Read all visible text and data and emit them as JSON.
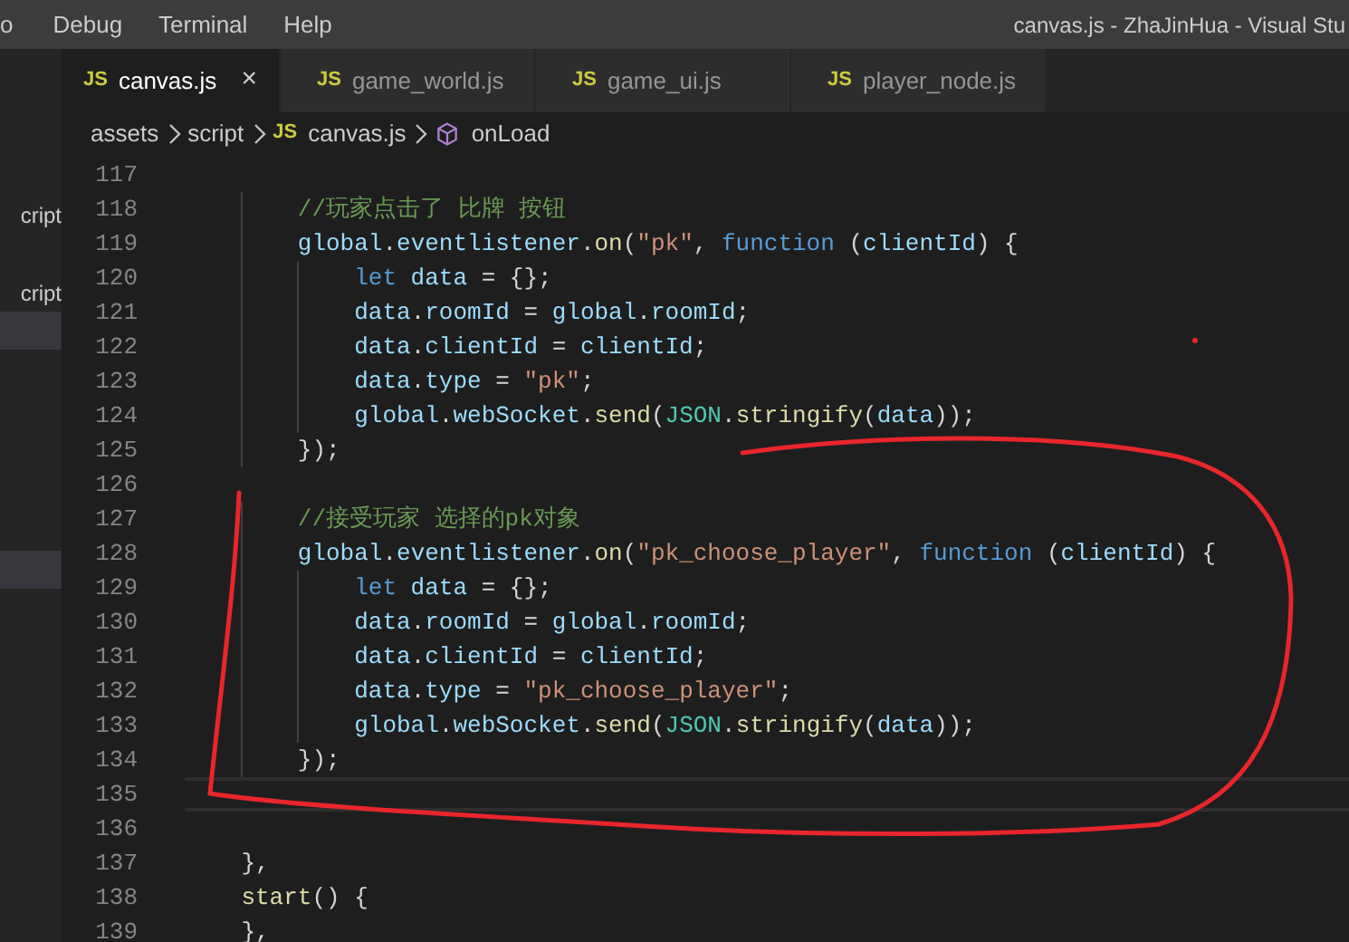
{
  "menu_bar": {
    "items": [
      "o",
      "Debug",
      "Terminal",
      "Help"
    ],
    "title": "canvas.js - ZhaJinHua - Visual Stu"
  },
  "sidebar": {
    "items": [
      {
        "label": "cript",
        "selected": false
      },
      {
        "label": "cript",
        "selected": false
      },
      {
        "selected": true
      },
      {
        "selected": true
      }
    ]
  },
  "tabs": [
    {
      "label": "canvas.js",
      "selected": true,
      "icon": "JS"
    },
    {
      "label": "game_world.js",
      "selected": false,
      "icon": "JS"
    },
    {
      "label": "game_ui.js",
      "selected": false,
      "icon": "JS"
    },
    {
      "label": "player_node.js",
      "selected": false,
      "icon": "JS"
    }
  ],
  "close_symbol": "×",
  "breadcrumb": [
    {
      "kind": "folder",
      "label": "assets"
    },
    {
      "kind": "folder",
      "label": "script"
    },
    {
      "kind": "file",
      "label": "canvas.js",
      "icon": "JS"
    },
    {
      "kind": "method",
      "label": "onLoad"
    }
  ],
  "editor": {
    "lines": [
      {
        "number": "117",
        "current": false
      },
      {
        "number": "118",
        "current": false,
        "tokens": [
          {
            "kind": "comment",
            "text": "//玩家点击了 比牌 按钮"
          }
        ]
      },
      {
        "number": "119",
        "current": false,
        "tokens": [
          {
            "kind": "var",
            "text": "global"
          },
          {
            "kind": "plain",
            "text": "."
          },
          {
            "kind": "var",
            "text": "eventlistener"
          },
          {
            "kind": "plain",
            "text": "."
          },
          {
            "kind": "func",
            "text": "on"
          },
          {
            "kind": "plain",
            "text": "("
          },
          {
            "kind": "string",
            "text": "\"pk\""
          },
          {
            "kind": "plain",
            "text": ", "
          },
          {
            "kind": "keyword",
            "text": "function"
          },
          {
            "kind": "plain",
            "text": " ("
          },
          {
            "kind": "var",
            "text": "clientId"
          },
          {
            "kind": "plain",
            "text": ") {"
          }
        ]
      },
      {
        "number": "120",
        "current": false,
        "tokens": [
          {
            "kind": "keyword",
            "text": "let"
          },
          {
            "kind": "var",
            "text": " data"
          },
          {
            "kind": "plain",
            "text": " = {};"
          }
        ]
      },
      {
        "number": "121",
        "current": false,
        "tokens": [
          {
            "kind": "var",
            "text": "data"
          },
          {
            "kind": "plain",
            "text": "."
          },
          {
            "kind": "var",
            "text": "roomId"
          },
          {
            "kind": "plain",
            "text": " = "
          },
          {
            "kind": "var",
            "text": "global"
          },
          {
            "kind": "plain",
            "text": "."
          },
          {
            "kind": "var",
            "text": "roomId"
          },
          {
            "kind": "plain",
            "text": ";"
          }
        ]
      },
      {
        "number": "122",
        "current": false,
        "tokens": [
          {
            "kind": "var",
            "text": "data"
          },
          {
            "kind": "plain",
            "text": "."
          },
          {
            "kind": "var",
            "text": "clientId"
          },
          {
            "kind": "plain",
            "text": " = "
          },
          {
            "kind": "var",
            "text": "clientId"
          },
          {
            "kind": "plain",
            "text": ";"
          }
        ]
      },
      {
        "number": "123",
        "current": false,
        "tokens": [
          {
            "kind": "var",
            "text": "data"
          },
          {
            "kind": "plain",
            "text": "."
          },
          {
            "kind": "var",
            "text": "type"
          },
          {
            "kind": "plain",
            "text": " = "
          },
          {
            "kind": "string",
            "text": "\"pk\""
          },
          {
            "kind": "plain",
            "text": ";"
          }
        ]
      },
      {
        "number": "124",
        "current": false,
        "tokens": [
          {
            "kind": "var",
            "text": "global"
          },
          {
            "kind": "plain",
            "text": "."
          },
          {
            "kind": "var",
            "text": "webSocket"
          },
          {
            "kind": "plain",
            "text": "."
          },
          {
            "kind": "func",
            "text": "send"
          },
          {
            "kind": "plain",
            "text": "("
          },
          {
            "kind": "type",
            "text": "JSON"
          },
          {
            "kind": "plain",
            "text": "."
          },
          {
            "kind": "func",
            "text": "stringify"
          },
          {
            "kind": "plain",
            "text": "("
          },
          {
            "kind": "var",
            "text": "data"
          },
          {
            "kind": "plain",
            "text": "));"
          }
        ]
      },
      {
        "number": "125",
        "current": false,
        "tokens": [
          {
            "kind": "plain",
            "text": "});"
          }
        ]
      },
      {
        "number": "126",
        "current": false
      },
      {
        "number": "127",
        "current": false,
        "tokens": [
          {
            "kind": "comment",
            "text": "//接受玩家 选择的pk对象"
          }
        ]
      },
      {
        "number": "128",
        "current": false,
        "tokens": [
          {
            "kind": "var",
            "text": "global"
          },
          {
            "kind": "plain",
            "text": "."
          },
          {
            "kind": "var",
            "text": "eventlistener"
          },
          {
            "kind": "plain",
            "text": "."
          },
          {
            "kind": "func",
            "text": "on"
          },
          {
            "kind": "plain",
            "text": "("
          },
          {
            "kind": "string",
            "text": "\"pk_choose_player\""
          },
          {
            "kind": "plain",
            "text": ", "
          },
          {
            "kind": "keyword",
            "text": "function"
          },
          {
            "kind": "plain",
            "text": " ("
          },
          {
            "kind": "var",
            "text": "clientId"
          },
          {
            "kind": "plain",
            "text": ") {"
          }
        ]
      },
      {
        "number": "129",
        "current": false,
        "tokens": [
          {
            "kind": "keyword",
            "text": "let"
          },
          {
            "kind": "var",
            "text": " data"
          },
          {
            "kind": "plain",
            "text": " = {};"
          }
        ]
      },
      {
        "number": "130",
        "current": false,
        "tokens": [
          {
            "kind": "var",
            "text": "data"
          },
          {
            "kind": "plain",
            "text": "."
          },
          {
            "kind": "var",
            "text": "roomId"
          },
          {
            "kind": "plain",
            "text": " = "
          },
          {
            "kind": "var",
            "text": "global"
          },
          {
            "kind": "plain",
            "text": "."
          },
          {
            "kind": "var",
            "text": "roomId"
          },
          {
            "kind": "plain",
            "text": ";"
          }
        ]
      },
      {
        "number": "131",
        "current": false,
        "tokens": [
          {
            "kind": "var",
            "text": "data"
          },
          {
            "kind": "plain",
            "text": "."
          },
          {
            "kind": "var",
            "text": "clientId"
          },
          {
            "kind": "plain",
            "text": " = "
          },
          {
            "kind": "var",
            "text": "clientId"
          },
          {
            "kind": "plain",
            "text": ";"
          }
        ]
      },
      {
        "number": "132",
        "current": false,
        "tokens": [
          {
            "kind": "var",
            "text": "data"
          },
          {
            "kind": "plain",
            "text": "."
          },
          {
            "kind": "var",
            "text": "type"
          },
          {
            "kind": "plain",
            "text": " = "
          },
          {
            "kind": "string",
            "text": "\"pk_choose_player\""
          },
          {
            "kind": "plain",
            "text": ";"
          }
        ]
      },
      {
        "number": "133",
        "current": false,
        "tokens": [
          {
            "kind": "var",
            "text": "global"
          },
          {
            "kind": "plain",
            "text": "."
          },
          {
            "kind": "var",
            "text": "webSocket"
          },
          {
            "kind": "plain",
            "text": "."
          },
          {
            "kind": "func",
            "text": "send"
          },
          {
            "kind": "plain",
            "text": "("
          },
          {
            "kind": "type",
            "text": "JSON"
          },
          {
            "kind": "plain",
            "text": "."
          },
          {
            "kind": "func",
            "text": "stringify"
          },
          {
            "kind": "plain",
            "text": "("
          },
          {
            "kind": "var",
            "text": "data"
          },
          {
            "kind": "plain",
            "text": "));"
          }
        ]
      },
      {
        "number": "134",
        "current": false,
        "tokens": [
          {
            "kind": "plain",
            "text": "});"
          }
        ]
      },
      {
        "number": "135",
        "current": true
      },
      {
        "number": "136",
        "current": false
      },
      {
        "number": "137",
        "current": false,
        "tokens": [
          {
            "kind": "plain",
            "text": "},"
          }
        ]
      },
      {
        "number": "138",
        "current": false,
        "tokens": [
          {
            "kind": "func",
            "text": "start"
          },
          {
            "kind": "plain",
            "text": "() {"
          }
        ]
      },
      {
        "number": "139",
        "current": false,
        "tokens": [
          {
            "kind": "plain",
            "text": "},"
          }
        ]
      }
    ]
  }
}
